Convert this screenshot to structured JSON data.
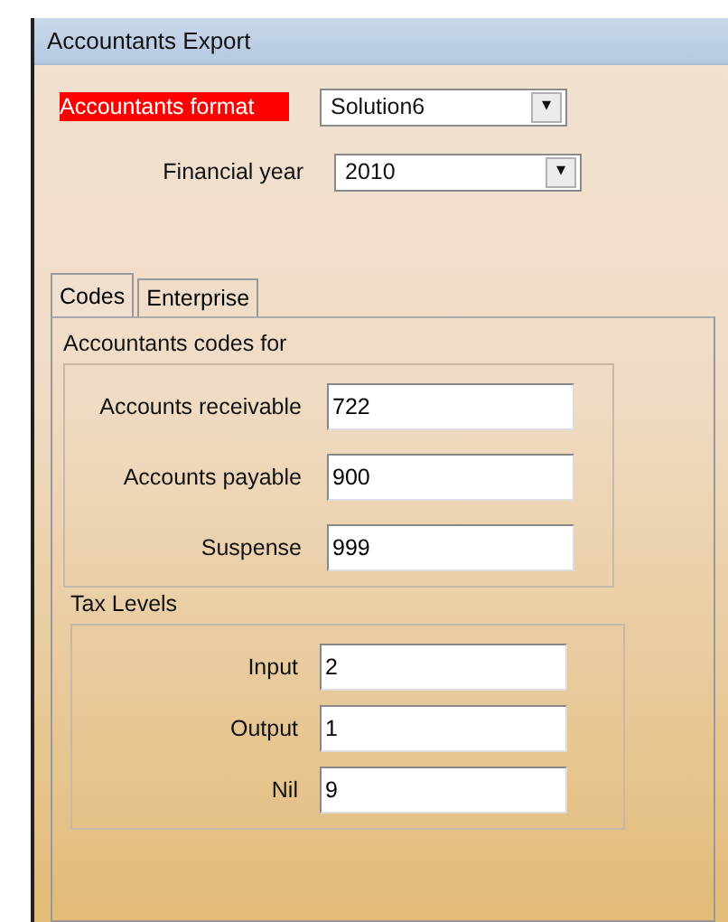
{
  "window": {
    "title": "Accountants Export"
  },
  "selectors": [
    {
      "label": "Accountants format",
      "highlighted": true,
      "value": "Solution6",
      "arrow": "▾"
    },
    {
      "label": "Financial year",
      "highlighted": false,
      "value": "2010",
      "arrow": "▾"
    }
  ],
  "tabs": [
    {
      "label": "Codes",
      "selected": true
    },
    {
      "label": "Enterprise",
      "selected": false
    }
  ],
  "groups": [
    {
      "title": "Accountants codes for",
      "fields": [
        {
          "label": "Accounts receivable",
          "value": "722"
        },
        {
          "label": "Accounts payable",
          "value": "900"
        },
        {
          "label": "Suspense",
          "value": "999"
        }
      ]
    },
    {
      "title": "Tax Levels",
      "fields": [
        {
          "label": "Input",
          "value": "2"
        },
        {
          "label": "Output",
          "value": "1"
        },
        {
          "label": "Nil",
          "value": "9"
        }
      ]
    }
  ]
}
